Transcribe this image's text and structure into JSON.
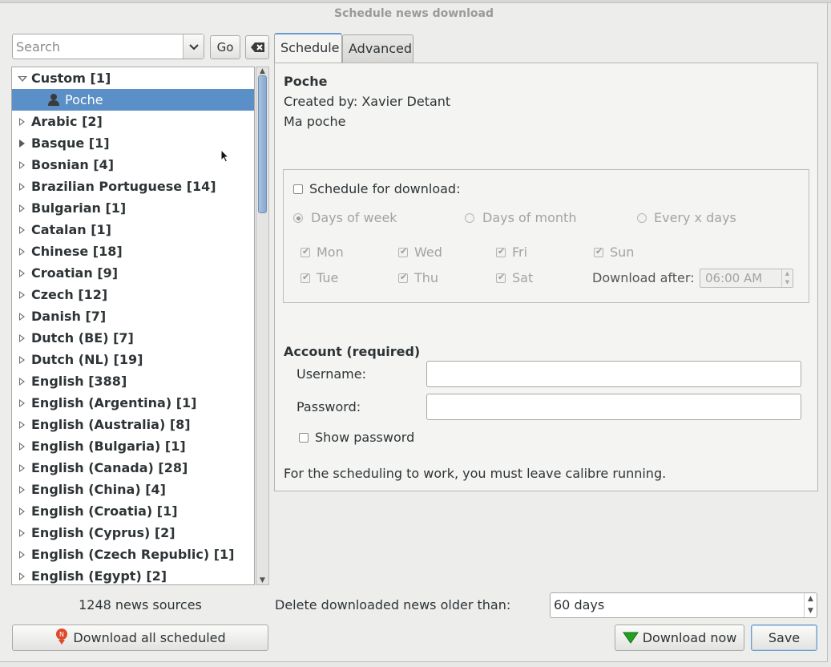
{
  "window": {
    "title": "Schedule news download"
  },
  "search": {
    "placeholder": "Search",
    "go_label": "Go"
  },
  "tree": {
    "items": [
      {
        "label": "Custom [1]",
        "state": "expanded"
      },
      {
        "label": "Poche",
        "state": "child-selected"
      },
      {
        "label": "Arabic [2]",
        "state": "collapsed"
      },
      {
        "label": "Basque [1]",
        "state": "collapsed"
      },
      {
        "label": "Bosnian [4]",
        "state": "collapsed"
      },
      {
        "label": "Brazilian Portuguese [14]",
        "state": "collapsed"
      },
      {
        "label": "Bulgarian [1]",
        "state": "collapsed"
      },
      {
        "label": "Catalan [1]",
        "state": "collapsed"
      },
      {
        "label": "Chinese [18]",
        "state": "collapsed"
      },
      {
        "label": "Croatian [9]",
        "state": "collapsed"
      },
      {
        "label": "Czech [12]",
        "state": "collapsed"
      },
      {
        "label": "Danish [7]",
        "state": "collapsed"
      },
      {
        "label": "Dutch (BE) [7]",
        "state": "collapsed"
      },
      {
        "label": "Dutch (NL) [19]",
        "state": "collapsed"
      },
      {
        "label": "English [388]",
        "state": "collapsed"
      },
      {
        "label": "English (Argentina) [1]",
        "state": "collapsed"
      },
      {
        "label": "English (Australia) [8]",
        "state": "collapsed"
      },
      {
        "label": "English (Bulgaria) [1]",
        "state": "collapsed"
      },
      {
        "label": "English (Canada) [28]",
        "state": "collapsed"
      },
      {
        "label": "English (China) [4]",
        "state": "collapsed"
      },
      {
        "label": "English (Croatia) [1]",
        "state": "collapsed"
      },
      {
        "label": "English (Cyprus) [2]",
        "state": "collapsed"
      },
      {
        "label": "English (Czech Republic) [1]",
        "state": "collapsed"
      },
      {
        "label": "English (Egypt) [2]",
        "state": "collapsed"
      }
    ]
  },
  "footer_left": {
    "count_text": "1248 news sources",
    "download_all_label": "Download all scheduled"
  },
  "tabs": {
    "schedule": "Schedule",
    "advanced": "Advanced"
  },
  "recipe": {
    "title": "Poche",
    "author": "Created by: Xavier Detant",
    "description": "Ma poche"
  },
  "schedule": {
    "enable_label": "Schedule for download:",
    "radio_days_of_week": "Days of  week",
    "radio_days_of_month": "Days of month",
    "radio_every_x_days": "Every x days",
    "days": [
      "Mon",
      "Wed",
      "Fri",
      "Sun",
      "Tue",
      "Thu",
      "Sat"
    ],
    "download_after_label": "Download after:",
    "download_after_value": "06:00 AM"
  },
  "account": {
    "heading": "Account (required)",
    "username_label": "Username:",
    "password_label": "Password:",
    "show_password_label": "Show password",
    "note": "For the scheduling to work, you must leave calibre running."
  },
  "footer_right": {
    "delete_label": "Delete downloaded news older than:",
    "delete_value": "60 days",
    "download_now_label": "Download now",
    "save_label": "Save"
  },
  "colors": {
    "selection": "#5b8fc7",
    "accent": "#6a9bd0",
    "save_icon": "#22a022",
    "download_all_icon": "#e0482c"
  }
}
